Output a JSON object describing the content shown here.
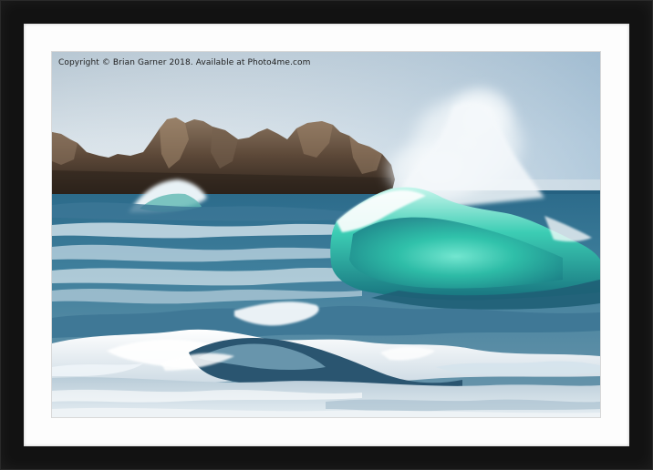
{
  "watermark": {
    "text": "Copyright  © Brian Garner  2018. Available at Photo4me.com"
  },
  "colors": {
    "frame": "#121212",
    "mount": "#fdfdfd",
    "sky": "#c9d6e0",
    "sea": "#2f6f8f",
    "wave_turquoise": "#35c7b0",
    "foam": "#eef3f6",
    "rock": "#5a4636"
  }
}
